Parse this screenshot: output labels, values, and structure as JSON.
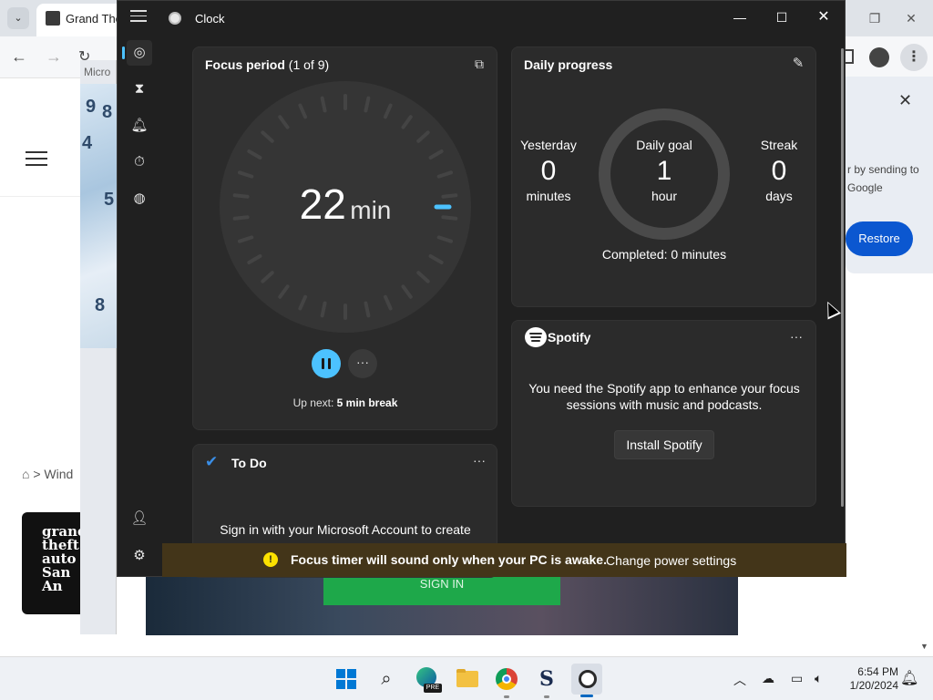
{
  "browser": {
    "tab_title": "Grand The",
    "window_snippet": "Micro",
    "popup_text": "r by sending to Google",
    "restore_label": "Restore",
    "breadcrumb_home": "⌂",
    "breadcrumb_text": "> Wind",
    "game_thumb_text": "grand theft auto San An",
    "signin_label": "SIGN IN"
  },
  "clock": {
    "title": "Clock",
    "nav": [
      "Focus sessions",
      "Timer",
      "Alarm",
      "Stopwatch",
      "World clock",
      "Account",
      "Settings"
    ],
    "focus": {
      "title": "Focus period",
      "subtitle": "(1 of 9)",
      "time_value": "22",
      "time_unit": "min",
      "progress_fraction": 0.27,
      "upnext_label": "Up next:",
      "upnext_value": "5 min break"
    },
    "daily": {
      "title": "Daily progress",
      "yesterday_label": "Yesterday",
      "yesterday_value": "0",
      "yesterday_unit": "minutes",
      "goal_label": "Daily goal",
      "goal_value": "1",
      "goal_unit": "hour",
      "streak_label": "Streak",
      "streak_value": "0",
      "streak_unit": "days",
      "completed": "Completed: 0 minutes"
    },
    "spotify": {
      "name": "Spotify",
      "message": "You need the Spotify app to enhance your focus sessions with music and podcasts.",
      "install_label": "Install Spotify"
    },
    "todo": {
      "title": "To Do",
      "message": "Sign in with your Microsoft Account to create"
    },
    "warning": {
      "text": "Focus timer will sound only when your PC is awake.",
      "link": "Change power settings"
    }
  },
  "taskbar": {
    "time": "6:54 PM",
    "date": "1/20/2024",
    "edge_badge": "PRE"
  },
  "colors": {
    "accent": "#4cc2ff",
    "warning_bg": "#433519",
    "warning_icon": "#fce100"
  }
}
